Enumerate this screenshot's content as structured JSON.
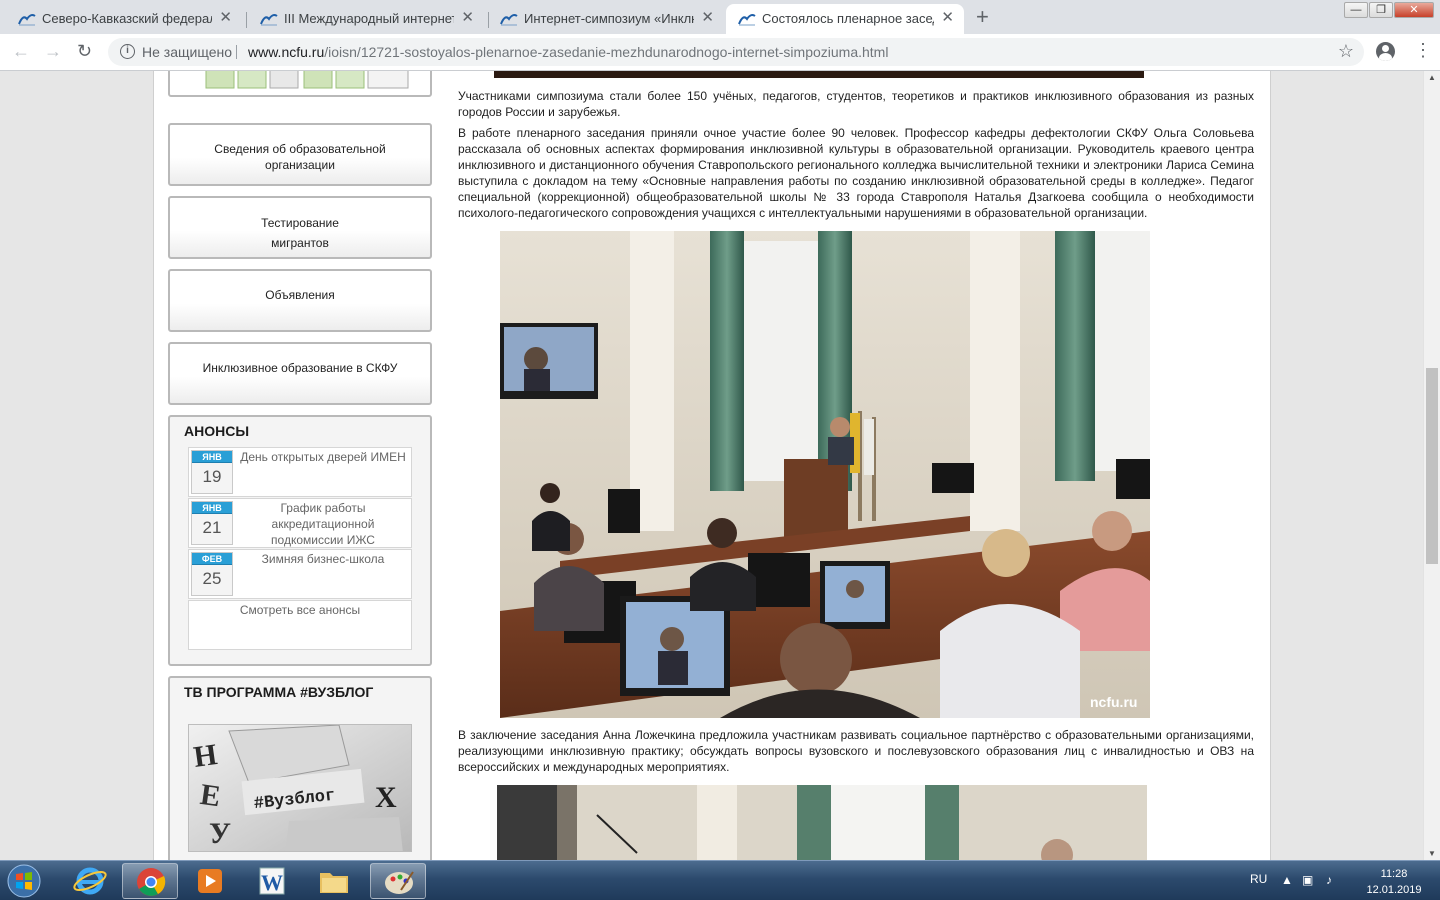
{
  "browser": {
    "tabs": [
      {
        "title": "Северо-Кавказский федеральный университет",
        "active": false
      },
      {
        "title": "III Международный интернет-симпозиум",
        "active": false
      },
      {
        "title": "Интернет-симпозиум «Инклюзивное образование»",
        "active": false
      },
      {
        "title": "Состоялось пленарное заседание",
        "active": true
      }
    ],
    "close_glyph": "✕",
    "new_tab_glyph": "+",
    "window_controls": {
      "minimize": "—",
      "maximize": "❐",
      "close": "✕"
    },
    "back_glyph": "←",
    "forward_glyph": "→",
    "reload_glyph": "↻",
    "security_label": "Не защищено",
    "url_host": "www.ncfu.ru",
    "url_path": "/ioisn/12721-sostoyalos-plenarnoe-zasedanie-mezhdunarodnogo-internet-simpoziuma.html",
    "bookmark_glyph": "☆",
    "menu_glyph": "⋮"
  },
  "sidebar": {
    "boxes": [
      {
        "lines": [
          "Сведения об образовательной",
          "организации"
        ]
      },
      {
        "lines": [
          "Тестирование",
          "мигрантов"
        ]
      },
      {
        "lines": [
          "Объявления"
        ]
      },
      {
        "lines": [
          "Инклюзивное образование в СКФУ"
        ]
      }
    ],
    "announcements": {
      "title": "АНОНСЫ",
      "items": [
        {
          "month": "ЯНВ",
          "day": "19",
          "text": "День открытых дверей ИМЕН"
        },
        {
          "month": "ЯНВ",
          "day": "21",
          "text": "График работы аккредитационной подкомиссии ИЖС"
        },
        {
          "month": "ФЕВ",
          "day": "25",
          "text": "Зимняя бизнес-школа"
        }
      ],
      "all_link": "Смотреть все анонсы"
    },
    "tv": {
      "title": "ТВ ПРОГРАММА #ВУЗБЛОГ",
      "image_text": "#Вузблог"
    }
  },
  "article": {
    "paragraphs": [
      "Участниками симпозиума стали более 150 учёных, педагогов, студентов, теоретиков и практиков инклюзивного образования из разных городов России и зарубежья.",
      "В работе пленарного заседания приняли очное участие более 90 человек. Профессор кафедры дефектологии СКФУ Ольга Соловьева рассказала об основных аспектах формирования инклюзивной культуры в образовательной организации. Руководитель краевого центра инклюзивного и дистанционного обучения Ставропольского регионального колледжа вычислительной техники и электроники Лариса Семина выступила с докладом на тему «Основные направления работы по созданию инклюзивной образовательной среды в колледже». Педагог специальной (коррекционной) общеобразовательной школы № 33 города Ставрополя Наталья Дзагкоева сообщила о необходимости психолого-педагогического сопровождения учащихся с интеллектуальными нарушениями в образовательной организации.",
      "В заключение заседания Анна Ложечкина предложила участникам развивать социальное партнёрство с образовательными организациями, реализующими инклюзивную практику; обсуждать вопросы вузовского и послевузовского образования лиц с инвалидностью и ОВЗ на всероссийских и международных мероприятиях."
    ],
    "photo_watermark": "ncfu.ru"
  },
  "taskbar": {
    "language": "RU",
    "time": "11:28",
    "date": "12.01.2019"
  },
  "colors": {
    "accent_blue": "#2a9fd6",
    "taskbar": "#2c4a6d"
  }
}
